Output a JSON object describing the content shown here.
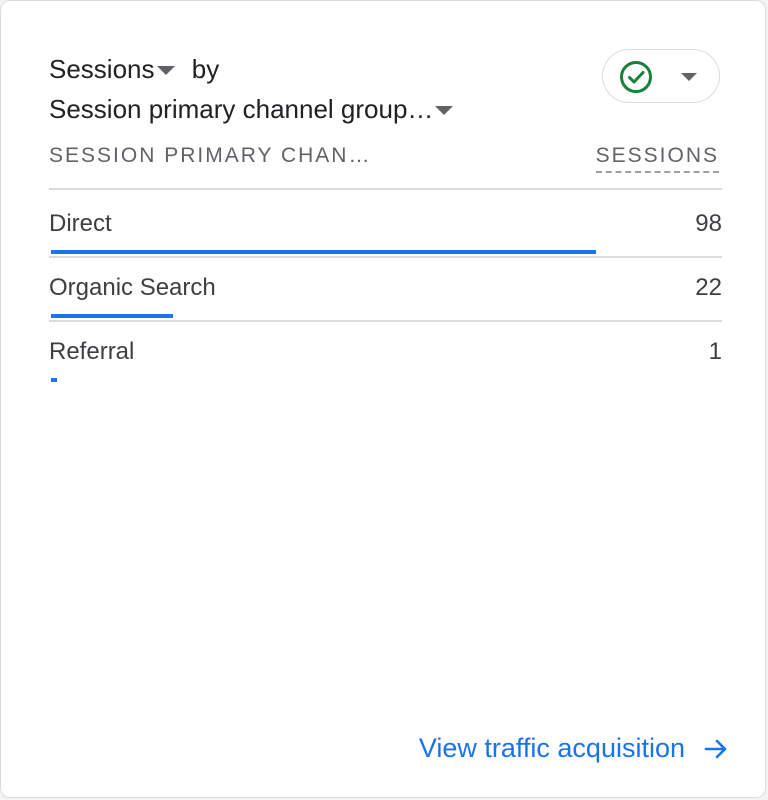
{
  "card": {
    "metric_label": "Sessions",
    "by_label": "by",
    "dimension_label": "Session primary channel group…",
    "status": {
      "icon": "check-circle-icon",
      "color": "#188038"
    }
  },
  "table": {
    "columns": [
      "SESSION PRIMARY CHAN…",
      "SESSIONS"
    ],
    "rows": [
      {
        "label": "Direct",
        "value": "98",
        "fraction": 1.0
      },
      {
        "label": "Organic Search",
        "value": "22",
        "fraction": 0.2245
      },
      {
        "label": "Referral",
        "value": "1",
        "fraction": 0.0102
      }
    ]
  },
  "footer": {
    "link_label": "View traffic acquisition",
    "icon": "arrow-right-icon"
  },
  "colors": {
    "accent": "#1a73e8",
    "divider": "#dadce0",
    "text": "#3c4043"
  }
}
